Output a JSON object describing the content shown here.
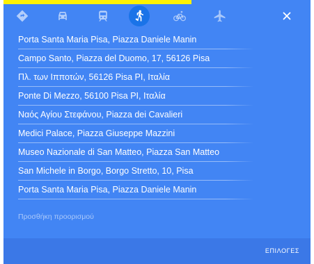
{
  "travel_modes": [
    {
      "name": "best-route",
      "icon": "diamond-route-icon"
    },
    {
      "name": "driving",
      "icon": "car-icon"
    },
    {
      "name": "transit",
      "icon": "train-icon"
    },
    {
      "name": "walking",
      "icon": "walking-icon",
      "selected": true
    },
    {
      "name": "cycling",
      "icon": "bicycle-icon"
    },
    {
      "name": "flights",
      "icon": "airplane-icon"
    }
  ],
  "stops": [
    "Porta Santa Maria Pisa, Piazza Daniele Manin",
    "Campo Santo, Piazza del Duomo, 17, 56126 Pisa",
    "Πλ. των Ιπποτών, 56126 Pisa PI, Ιταλία",
    "Ponte Di Mezzo, 56100 Pisa PI, Ιταλία",
    "Ναός Αγίου Στεφάνου, Piazza dei Cavalieri",
    "Medici Palace, Piazza Giuseppe Mazzini",
    "Museo Nazionale di San Matteo, Piazza San Matteo",
    "San Michele in Borgo, Borgo Stretto, 10, Pisa",
    "Porta Santa Maria Pisa, Piazza Daniele Manin"
  ],
  "add_destination_label": "Προσθήκη προορισμού",
  "options_label": "ΕΠΙΛΟΓΕΣ",
  "colors": {
    "panel": "#4285f4",
    "footer": "#3b78e7",
    "highlight": "#fff200"
  }
}
